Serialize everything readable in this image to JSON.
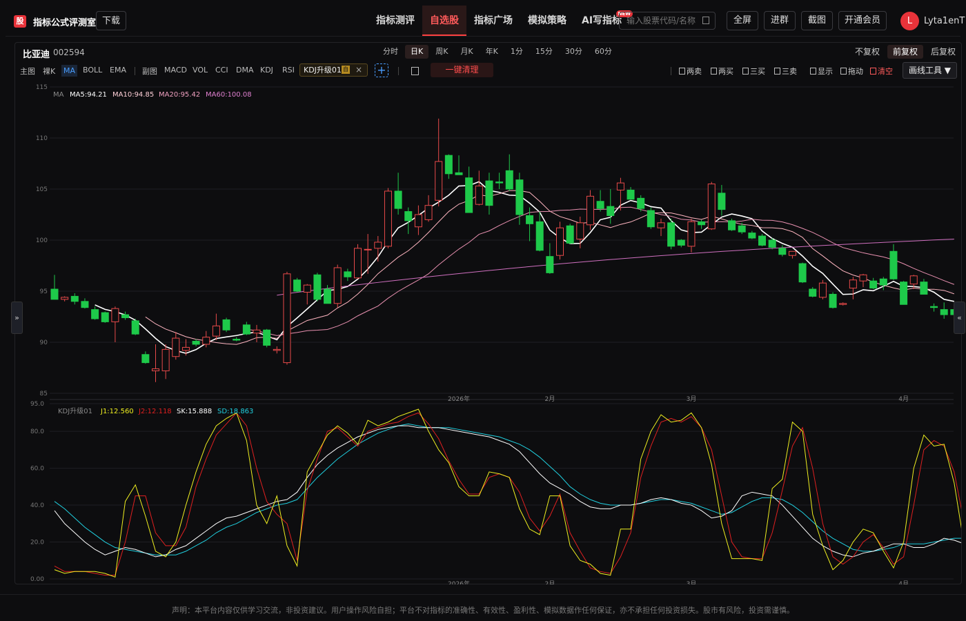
{
  "app": {
    "logo_char": "股",
    "title": "指标公式评测室",
    "download": "下载"
  },
  "nav": [
    "指标测评",
    "自选股",
    "指标广场",
    "模拟策略",
    "AI写指标"
  ],
  "nav_active": 1,
  "nav_new_badge": "NEW",
  "search": {
    "placeholder": "输入股票代码/名称"
  },
  "top_buttons": [
    "全屏",
    "进群",
    "截图",
    "开通会员"
  ],
  "user": {
    "avatar_letter": "L",
    "name": "Lyta1enT"
  },
  "stock": {
    "name": "比亚迪",
    "code": "002594"
  },
  "periods": [
    "分时",
    "日K",
    "周K",
    "月K",
    "年K",
    "1分",
    "15分",
    "30分",
    "60分"
  ],
  "period_active": 1,
  "fuquan": [
    "不复权",
    "前复权",
    "后复权"
  ],
  "fuquan_active": 1,
  "main_tabs": [
    "主图",
    "裸K",
    "MA",
    "BOLL",
    "EMA"
  ],
  "main_active": 2,
  "sub_tabs": [
    "副图",
    "MACD",
    "VOL",
    "CCI",
    "DMA",
    "KDJ",
    "RSI"
  ],
  "kdj_tag": {
    "label": "KDJ升级01",
    "self": "自"
  },
  "clear_all": "一键清理",
  "signals": [
    "两卖",
    "两买",
    "三买",
    "三卖",
    "显示",
    "拖动",
    "清空"
  ],
  "draw_tools": "画线工具",
  "side_left": "»",
  "side_right": "«",
  "ma_legend": {
    "label": "MA",
    "ma5": "MA5:94.21",
    "ma10": "MA10:94.85",
    "ma20": "MA20:95.42",
    "ma60": "MA60:100.08"
  },
  "kdj_legend": {
    "label": "KDJ升级01",
    "j1": "J1:12.560",
    "j2": "J2:12.118",
    "sk": "SK:15.888",
    "sd": "SD:18.863"
  },
  "colors": {
    "up": "#e84a4a",
    "down": "#1ec94a",
    "ma5": "#ffffff",
    "ma10": "#ffb6c1",
    "ma20": "#e890b0",
    "ma60": "#d070c0",
    "j1": "#f0f020",
    "j2": "#e02020",
    "sk": "#ffffff",
    "sd": "#20d0e0"
  },
  "footer": "声明：本平台内容仅供学习交流，非投资建议。用户操作风险自担；平台不对指标的准确性、有效性、盈利性、模拟数据作任何保证，亦不承担任何投资损失。股市有风险，投资需谨慎。",
  "chart_data": [
    {
      "type": "candlestick",
      "title": "比亚迪 002594 日K",
      "ylim": [
        85,
        115
      ],
      "yticks": [
        85,
        90,
        95,
        100,
        105,
        110,
        115
      ],
      "xticks": [
        {
          "index": 40,
          "label": "2026年"
        },
        {
          "index": 49,
          "label": "2月"
        },
        {
          "index": 63,
          "label": "3月"
        },
        {
          "index": 84,
          "label": "4月"
        }
      ],
      "candles": [
        [
          95.2,
          96.6,
          94.5,
          94.2
        ],
        [
          94.2,
          94.5,
          94.0,
          94.4
        ],
        [
          94.5,
          94.8,
          93.7,
          94.0
        ],
        [
          94.0,
          94.3,
          93.3,
          93.4
        ],
        [
          93.2,
          93.5,
          92.2,
          92.3
        ],
        [
          92.9,
          93.0,
          91.9,
          92.0
        ],
        [
          92.0,
          93.5,
          90.0,
          93.3
        ],
        [
          92.7,
          93.0,
          92.2,
          92.4
        ],
        [
          92.1,
          92.3,
          90.7,
          90.8
        ],
        [
          88.8,
          89.1,
          87.9,
          88.0
        ],
        [
          87.2,
          89.8,
          86.1,
          87.4
        ],
        [
          87.2,
          89.8,
          86.4,
          89.3
        ],
        [
          88.6,
          91.0,
          88.3,
          90.4
        ],
        [
          89.2,
          90.3,
          88.7,
          89.5
        ],
        [
          90.1,
          90.3,
          89.6,
          89.8
        ],
        [
          89.8,
          91.1,
          89.5,
          90.5
        ],
        [
          90.6,
          92.8,
          90.2,
          91.6
        ],
        [
          92.2,
          92.4,
          91.0,
          91.2
        ],
        [
          90.3,
          90.5,
          90.1,
          90.2
        ],
        [
          91.7,
          92.0,
          90.7,
          90.8
        ],
        [
          90.9,
          91.7,
          90.0,
          91.2
        ],
        [
          91.2,
          91.3,
          89.5,
          89.7
        ],
        [
          89.2,
          89.6,
          88.9,
          89.3
        ],
        [
          88.0,
          96.9,
          87.8,
          96.7
        ],
        [
          96.1,
          96.3,
          94.9,
          95.0
        ],
        [
          94.9,
          95.7,
          93.7,
          95.6
        ],
        [
          96.6,
          96.8,
          94.0,
          94.2
        ],
        [
          95.2,
          95.6,
          93.8,
          93.8
        ],
        [
          93.8,
          97.6,
          93.4,
          97.3
        ],
        [
          96.9,
          97.2,
          96.0,
          96.4
        ],
        [
          96.3,
          99.6,
          96.2,
          99.2
        ],
        [
          99.1,
          100.6,
          96.7,
          99.1
        ],
        [
          99.2,
          100.4,
          97.9,
          99.8
        ],
        [
          99.4,
          105.1,
          99.2,
          104.8
        ],
        [
          104.8,
          106.6,
          102.5,
          103.1
        ],
        [
          102.8,
          103.2,
          100.6,
          101.9
        ],
        [
          101.3,
          103.4,
          100.5,
          102.5
        ],
        [
          102.0,
          104.4,
          101.8,
          103.4
        ],
        [
          103.9,
          111.9,
          103.3,
          107.7
        ],
        [
          108.3,
          108.4,
          106.0,
          106.5
        ],
        [
          106.6,
          108.3,
          106.4,
          106.4
        ],
        [
          106.1,
          107.2,
          102.9,
          102.7
        ],
        [
          103.5,
          106.8,
          103.4,
          105.3
        ],
        [
          105.8,
          106.6,
          102.5,
          103.4
        ],
        [
          105.7,
          106.6,
          105.0,
          105.6
        ],
        [
          106.8,
          108.4,
          104.8,
          105.0
        ],
        [
          105.9,
          106.6,
          101.5,
          102.5
        ],
        [
          102.4,
          103.2,
          99.9,
          101.6
        ],
        [
          101.8,
          102.8,
          98.9,
          99.0
        ],
        [
          98.4,
          99.7,
          96.7,
          96.8
        ],
        [
          98.5,
          101.8,
          98.1,
          101.2
        ],
        [
          101.4,
          101.6,
          99.6,
          99.7
        ],
        [
          100.1,
          102.3,
          99.2,
          101.7
        ],
        [
          101.5,
          104.9,
          101.0,
          104.3
        ],
        [
          103.8,
          104.9,
          102.8,
          103.1
        ],
        [
          103.3,
          105.0,
          101.6,
          102.4
        ],
        [
          104.9,
          106.1,
          102.9,
          105.6
        ],
        [
          104.9,
          105.2,
          104.0,
          104.0
        ],
        [
          104.1,
          104.4,
          102.8,
          103.1
        ],
        [
          102.9,
          103.2,
          101.1,
          101.3
        ],
        [
          101.2,
          102.1,
          100.4,
          101.7
        ],
        [
          101.7,
          102.1,
          99.1,
          99.4
        ],
        [
          100.0,
          100.1,
          99.3,
          99.5
        ],
        [
          99.4,
          102.1,
          98.8,
          101.8
        ],
        [
          101.8,
          102.0,
          101.1,
          101.5
        ],
        [
          101.1,
          105.7,
          101.0,
          105.5
        ],
        [
          104.6,
          105.4,
          102.4,
          103.0
        ],
        [
          101.9,
          102.1,
          100.9,
          101.0
        ],
        [
          101.4,
          101.7,
          100.6,
          100.8
        ],
        [
          100.7,
          100.9,
          100.1,
          100.2
        ],
        [
          100.4,
          100.6,
          99.4,
          99.5
        ],
        [
          100.0,
          100.2,
          99.1,
          99.3
        ],
        [
          99.2,
          99.5,
          98.4,
          98.6
        ],
        [
          98.5,
          98.7,
          98.2,
          98.9
        ],
        [
          97.7,
          97.8,
          95.8,
          95.9
        ],
        [
          95.2,
          95.4,
          94.4,
          94.5
        ],
        [
          94.4,
          96.1,
          94.2,
          95.8
        ],
        [
          94.7,
          94.9,
          93.3,
          93.4
        ],
        [
          93.7,
          93.9,
          93.6,
          93.8
        ],
        [
          95.3,
          96.4,
          94.2,
          96.1
        ],
        [
          96.0,
          96.7,
          95.4,
          96.6
        ],
        [
          96.0,
          96.3,
          95.2,
          95.3
        ],
        [
          96.2,
          96.4,
          95.1,
          95.6
        ],
        [
          98.9,
          99.6,
          96.1,
          96.2
        ],
        [
          95.9,
          96.0,
          94.0,
          93.7
        ],
        [
          95.7,
          96.6,
          95.2,
          96.5
        ],
        [
          95.9,
          96.2,
          94.7,
          94.7
        ],
        [
          93.5,
          93.8,
          93.0,
          93.4
        ],
        [
          93.2,
          93.9,
          92.3,
          92.7
        ],
        [
          93.2,
          93.8,
          92.4,
          92.7
        ]
      ],
      "ma5_end": 94.21,
      "ma10_end": 94.85,
      "ma20_end": 95.42,
      "ma60_end": 100.08
    },
    {
      "type": "line",
      "title": "KDJ升级01",
      "ylim": [
        0,
        95
      ],
      "yticks": [
        0,
        20,
        40,
        60,
        80,
        95
      ],
      "series": [
        {
          "name": "J1",
          "values": [
            5,
            3,
            4,
            4,
            4,
            3,
            1,
            42,
            51,
            34,
            15,
            12,
            20,
            40,
            58,
            73,
            83,
            87,
            90,
            75,
            40,
            30,
            45,
            18,
            7,
            58,
            68,
            78,
            83,
            79,
            73,
            86,
            83,
            85,
            88,
            90,
            92,
            80,
            70,
            63,
            50,
            45,
            45,
            58,
            57,
            55,
            38,
            27,
            24,
            45,
            45,
            18,
            10,
            8,
            3,
            2,
            27,
            27,
            65,
            80,
            89,
            85,
            86,
            90,
            82,
            62,
            30,
            11,
            11,
            11,
            10,
            49,
            54,
            85,
            80,
            35,
            18,
            5,
            10,
            20,
            27,
            25,
            15,
            6,
            20,
            60,
            78,
            72,
            73,
            52,
            18,
            38,
            30,
            10
          ]
        },
        {
          "name": "J2",
          "values": [
            7,
            4,
            4,
            4,
            3,
            2,
            2,
            20,
            45,
            45,
            25,
            18,
            18,
            28,
            50,
            65,
            78,
            84,
            90,
            83,
            60,
            42,
            35,
            30,
            10,
            48,
            65,
            80,
            82,
            77,
            72,
            80,
            82,
            84,
            85,
            88,
            90,
            84,
            76,
            64,
            54,
            46,
            46,
            55,
            57,
            55,
            47,
            33,
            26,
            34,
            46,
            25,
            15,
            6,
            4,
            3,
            12,
            25,
            55,
            72,
            85,
            87,
            85,
            88,
            82,
            70,
            45,
            20,
            12,
            11,
            11,
            25,
            48,
            72,
            82,
            60,
            30,
            12,
            8,
            12,
            20,
            24,
            17,
            8,
            12,
            40,
            70,
            75,
            72,
            58,
            30,
            30,
            32,
            15
          ]
        },
        {
          "name": "SK",
          "values": [
            37,
            30,
            25,
            20,
            16,
            13,
            15,
            17,
            16,
            14,
            12,
            13,
            16,
            18,
            22,
            26,
            30,
            33,
            34,
            36,
            38,
            40,
            42,
            43,
            47,
            55,
            62,
            67,
            71,
            74,
            77,
            79,
            81,
            82,
            83,
            83,
            82,
            82,
            82,
            81,
            80,
            79,
            78,
            77,
            75,
            73,
            69,
            63,
            57,
            52,
            49,
            46,
            42,
            39,
            38,
            38,
            40,
            40,
            41,
            43,
            44,
            43,
            41,
            40,
            37,
            33,
            34,
            37,
            45,
            47,
            46,
            45,
            40,
            34,
            28,
            22,
            18,
            15,
            13,
            12,
            14,
            15,
            17,
            19,
            19,
            17,
            17,
            19,
            22,
            21,
            19,
            17,
            16,
            15
          ]
        },
        {
          "name": "SD",
          "values": [
            42,
            38,
            33,
            28,
            24,
            20,
            17,
            16,
            15,
            14,
            13,
            13,
            13,
            15,
            18,
            21,
            25,
            28,
            30,
            33,
            36,
            38,
            40,
            41,
            43,
            49,
            55,
            60,
            65,
            69,
            73,
            76,
            79,
            81,
            83,
            84,
            83,
            82,
            82,
            82,
            81,
            80,
            79,
            78,
            77,
            75,
            73,
            70,
            66,
            61,
            56,
            50,
            46,
            43,
            41,
            40,
            40,
            40,
            41,
            42,
            43,
            43,
            42,
            41,
            39,
            37,
            35,
            36,
            39,
            42,
            44,
            44,
            43,
            40,
            36,
            31,
            26,
            22,
            19,
            16,
            15,
            15,
            16,
            17,
            19,
            19,
            19,
            20,
            21,
            22,
            22,
            21,
            20,
            19
          ]
        }
      ]
    }
  ]
}
